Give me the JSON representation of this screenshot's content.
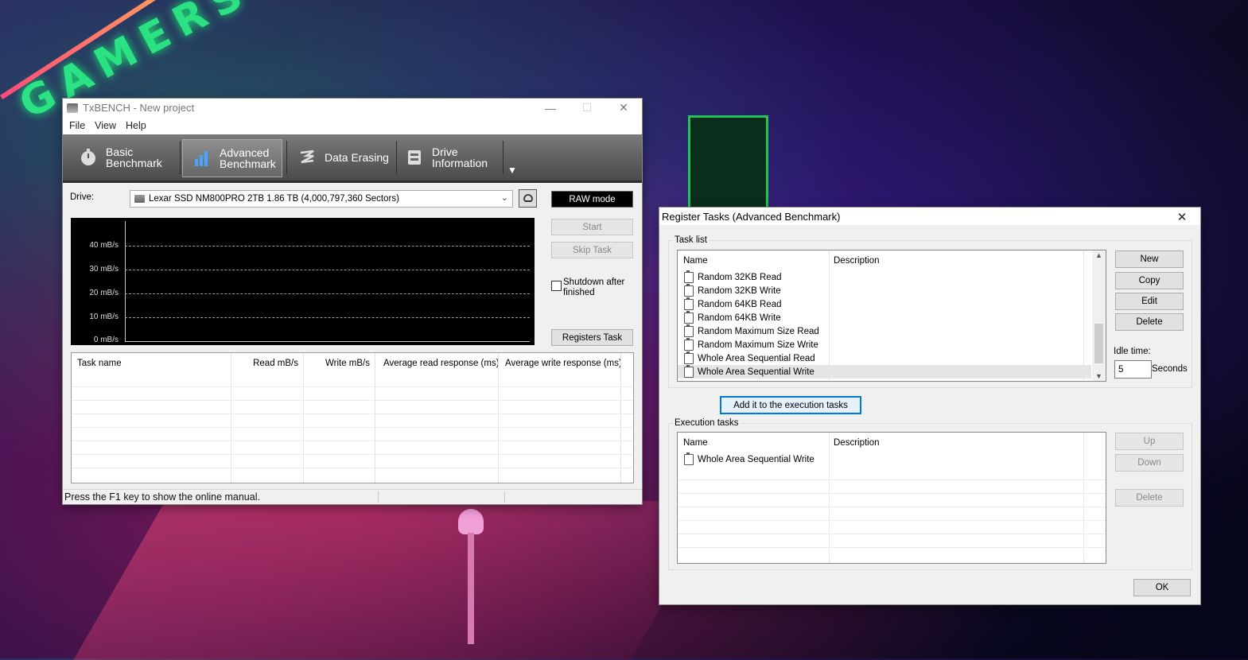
{
  "desktop": {
    "wallpaper_text": "GAMERS"
  },
  "txbench": {
    "title": "TxBENCH - New project",
    "menu": [
      "File",
      "View",
      "Help"
    ],
    "tabs": [
      {
        "line1": "Basic",
        "line2": "Benchmark",
        "icon": "stopwatch-icon"
      },
      {
        "line1": "Advanced",
        "line2": "Benchmark",
        "icon": "bar-chart-icon"
      },
      {
        "line1": "Data Erasing",
        "line2": "",
        "icon": "eraser-icon"
      },
      {
        "line1": "Drive",
        "line2": "Information",
        "icon": "drive-info-icon"
      }
    ],
    "drive_label": "Drive:",
    "drive_value": "Lexar SSD NM800PRO 2TB  1.86 TB (4,000,797,360 Sectors)",
    "raw_mode": "RAW mode",
    "start": "Start",
    "skip_task": "Skip Task",
    "shutdown": "Shutdown after finished",
    "registers_task": "Registers Task",
    "graph_labels": [
      "40 mB/s",
      "30 mB/s",
      "20 mB/s",
      "10 mB/s",
      "0 mB/s"
    ],
    "columns": [
      "Task name",
      "Read mB/s",
      "Write mB/s",
      "Average read response (ms)",
      "Average write response (ms)"
    ],
    "status": "Press the F1 key to show the online manual."
  },
  "dialog": {
    "title": "Register Tasks (Advanced Benchmark)",
    "task_list_label": "Task list",
    "col_name": "Name",
    "col_description": "Description",
    "tasks": [
      "Random 32KB Read",
      "Random 32KB Write",
      "Random 64KB Read",
      "Random 64KB Write",
      "Random Maximum Size Read",
      "Random Maximum Size Write",
      "Whole Area Sequential Read",
      "Whole Area Sequential Write"
    ],
    "buttons": {
      "new": "New",
      "copy": "Copy",
      "edit": "Edit",
      "delete": "Delete"
    },
    "idle_label": "Idle time:",
    "idle_value": "5",
    "idle_unit": "Seconds",
    "add_button": "Add it to the execution tasks",
    "exec_label": "Execution tasks",
    "exec_tasks": [
      "Whole Area Sequential Write"
    ],
    "exec_buttons": {
      "up": "Up",
      "down": "Down",
      "delete": "Delete"
    },
    "ok": "OK"
  }
}
